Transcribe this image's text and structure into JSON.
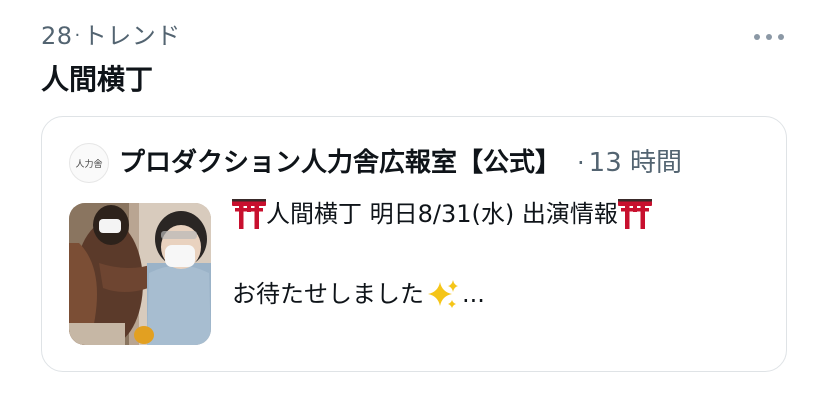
{
  "trend": {
    "rank": "28",
    "separator": "·",
    "category": "トレンド",
    "title": "人間横丁"
  },
  "card": {
    "avatar_text": "人力舎",
    "author": "プロダクション人力舎広報室【公式】",
    "time_sep": "·",
    "time": "13 時間",
    "line1_text": "人間横丁 明日8/31(水) 出演情報",
    "line2_text": "お待たせしました",
    "line2_suffix": "...",
    "icons": [
      "torii-gate-icon",
      "sparkles-icon",
      "more-icon"
    ],
    "colors": {
      "meta": "#536471",
      "title": "#0f1419",
      "border": "#dfe3e6",
      "torii": "#c8102e",
      "sparkle": "#f5c518"
    }
  }
}
